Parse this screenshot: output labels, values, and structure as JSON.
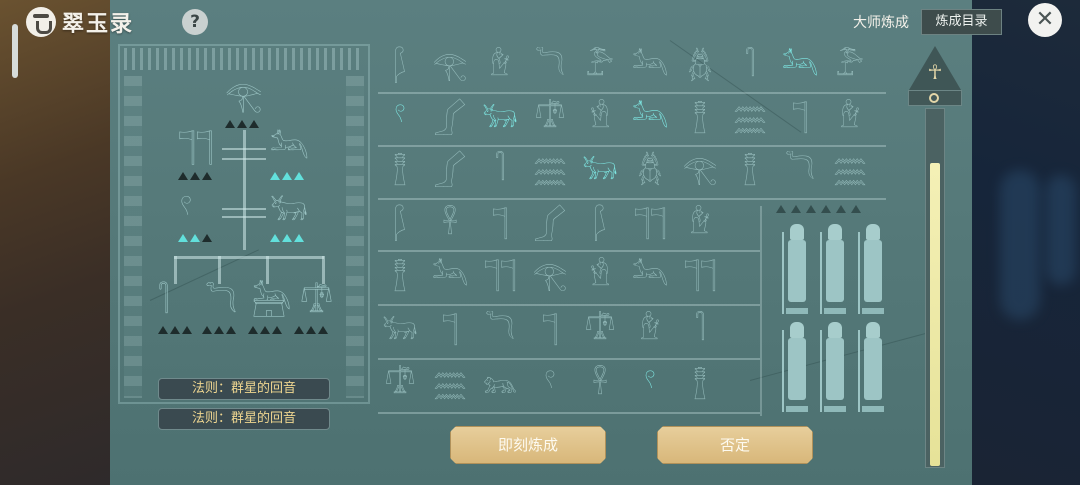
{
  "header": {
    "app_title": "翠玉录",
    "help_label": "?",
    "master_label": "大师炼成",
    "catalog_label": "炼成目录",
    "close_label": "✕"
  },
  "recipe": {
    "top": {
      "glyph": "𓂀",
      "state": "dim"
    },
    "mid_left": {
      "glyph": "𓊹𓊹",
      "state": "dim"
    },
    "mid_right": {
      "glyph": "𓃢",
      "state": "dim"
    },
    "low_left": {
      "glyph": "𓍢",
      "state": "dim"
    },
    "low_right": {
      "glyph": "𓃒",
      "state": "dim"
    },
    "bottom": [
      {
        "glyph": "𓋿"
      },
      {
        "glyph": "𓆓"
      },
      {
        "glyph": "𓃣"
      },
      {
        "glyph": "𓍝"
      }
    ],
    "rules": [
      "法则：群星的回音",
      "法则：群星的回音"
    ]
  },
  "grid": {
    "rows": [
      [
        {
          "g": "𓆄",
          "s": "dim"
        },
        {
          "g": "𓂀",
          "s": "dim"
        },
        {
          "g": "𓁞",
          "s": "dim"
        },
        {
          "g": "𓆓",
          "s": "dim"
        },
        {
          "g": "𓅤",
          "s": "dim"
        },
        {
          "g": "𓃢",
          "s": "dim"
        },
        {
          "g": "𓆣",
          "s": "dim"
        },
        {
          "g": "𓋿",
          "s": "dim"
        },
        {
          "g": "𓃢",
          "s": "lit"
        },
        {
          "g": "𓅤",
          "s": "dim"
        }
      ],
      [
        {
          "g": "𓍢",
          "s": "lit"
        },
        {
          "g": "𓂾",
          "s": "dim"
        },
        {
          "g": "𓃒",
          "s": "lit"
        },
        {
          "g": "𓍝",
          "s": "dim"
        },
        {
          "g": "𓁛",
          "s": "dim"
        },
        {
          "g": "𓃢",
          "s": "lit"
        },
        {
          "g": "𓊽",
          "s": "dim"
        },
        {
          "g": "𓈗",
          "s": "dim"
        },
        {
          "g": "𓊹",
          "s": "dim"
        },
        {
          "g": "𓁞",
          "s": "dim"
        }
      ],
      [
        {
          "g": "𓊽",
          "s": "dim"
        },
        {
          "g": "𓂾",
          "s": "dim"
        },
        {
          "g": "𓋿",
          "s": "dim"
        },
        {
          "g": "𓈗",
          "s": "dim"
        },
        {
          "g": "𓃒",
          "s": "lit"
        },
        {
          "g": "𓆣",
          "s": "dim"
        },
        {
          "g": "𓂀",
          "s": "dim"
        },
        {
          "g": "𓊽",
          "s": "dim"
        },
        {
          "g": "𓆓",
          "s": "dim"
        },
        {
          "g": "𓈗",
          "s": "dim"
        }
      ],
      [
        {
          "g": "𓆄",
          "s": "dim"
        },
        {
          "g": "𓋹",
          "s": "dim"
        },
        {
          "g": "𓊹",
          "s": "dim"
        },
        {
          "g": "𓂾",
          "s": "dim"
        },
        {
          "g": "𓆄",
          "s": "dim"
        },
        {
          "g": "𓊹𓊹",
          "s": "dim"
        },
        {
          "g": "𓁞",
          "s": "dim"
        }
      ],
      [
        {
          "g": "𓊽",
          "s": "dim"
        },
        {
          "g": "𓃢",
          "s": "dim"
        },
        {
          "g": "𓊹𓊹",
          "s": "dim"
        },
        {
          "g": "𓂀",
          "s": "dim"
        },
        {
          "g": "𓁛",
          "s": "dim"
        },
        {
          "g": "𓃢",
          "s": "dim"
        },
        {
          "g": "𓊹𓊹",
          "s": "dim"
        }
      ],
      [
        {
          "g": "𓃒",
          "s": "dim"
        },
        {
          "g": "𓊹",
          "s": "dim"
        },
        {
          "g": "𓆓",
          "s": "dim"
        },
        {
          "g": "𓊹",
          "s": "dim"
        },
        {
          "g": "𓍝",
          "s": "dim"
        },
        {
          "g": "𓁞",
          "s": "dim"
        },
        {
          "g": "𓋿",
          "s": "dim"
        }
      ],
      [
        {
          "g": "𓍝",
          "s": "dim"
        },
        {
          "g": "𓈗",
          "s": "dim"
        },
        {
          "g": "𓃬",
          "s": "dim"
        },
        {
          "g": "𓍢",
          "s": "dim"
        },
        {
          "g": "𓋹",
          "s": "dim"
        },
        {
          "g": "𓍢",
          "s": "lit"
        },
        {
          "g": "𓊽",
          "s": "dim"
        }
      ]
    ]
  },
  "actions": {
    "engrave_label": "即刻炼成",
    "reject_label": "否定"
  },
  "progress": {
    "fill_fraction": 0.85,
    "ankh": "☥"
  },
  "colors": {
    "panel": "#567a7a",
    "glyph_dim": "#a5cccc",
    "glyph_lit": "#7ee7e3",
    "button_gold": "#ddbd82",
    "rule_text": "#efd690"
  }
}
